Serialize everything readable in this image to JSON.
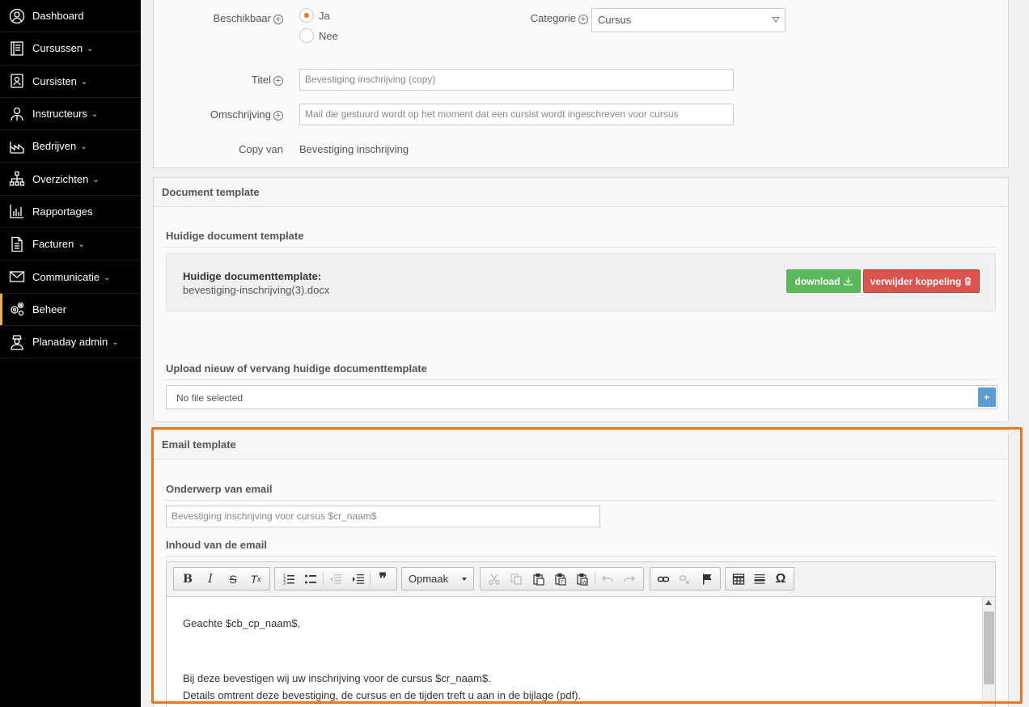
{
  "sidebar": {
    "items": [
      {
        "label": "Dashboard",
        "icon": "user-circle-icon",
        "chevron": false
      },
      {
        "label": "Cursussen",
        "icon": "book-icon",
        "chevron": true
      },
      {
        "label": "Cursisten",
        "icon": "contact-card-icon",
        "chevron": true
      },
      {
        "label": "Instructeurs",
        "icon": "instructor-icon",
        "chevron": true
      },
      {
        "label": "Bedrijven",
        "icon": "factory-icon",
        "chevron": true
      },
      {
        "label": "Overzichten",
        "icon": "sitemap-icon",
        "chevron": true
      },
      {
        "label": "Rapportages",
        "icon": "bar-chart-icon",
        "chevron": false
      },
      {
        "label": "Facturen",
        "icon": "invoice-icon",
        "chevron": true
      },
      {
        "label": "Communicatie",
        "icon": "envelope-icon",
        "chevron": true
      },
      {
        "label": "Beheer",
        "icon": "gears-icon",
        "chevron": false
      },
      {
        "label": "Planaday admin",
        "icon": "admin-icon",
        "chevron": true
      }
    ],
    "chevron_glyph": "⌄",
    "active_accent": "#f0ad4e"
  },
  "form": {
    "beschikbaar_label": "Beschikbaar",
    "radio_ja": "Ja",
    "radio_nee": "Nee",
    "categorie_label": "Categorie",
    "categorie_value": "Cursus",
    "titel_label": "Titel",
    "titel_placeholder": "Bevestiging inschrijving (copy)",
    "omschrijving_label": "Omschrijving",
    "omschrijving_placeholder": "Mail die gestuurd wordt op het moment dat een cursist wordt ingeschreven voor cursus",
    "copy_van_label": "Copy van",
    "copy_van_value": "Bevestiging inschrijving",
    "plus_glyph": "+"
  },
  "document_template": {
    "header": "Document template",
    "current_heading": "Huidige document template",
    "current_label": "Huidige documenttemplate:",
    "current_file": "bevestiging-inschrijving(3).docx",
    "download_label": "download",
    "remove_label": "verwijder koppeling",
    "upload_heading": "Upload nieuw of vervang huidige documenttemplate",
    "file_input_text": "No file selected"
  },
  "email_template": {
    "header": "Email template",
    "subject_heading": "Onderwerp van email",
    "subject_placeholder": "Bevestiging inschrijving voor cursus $cr_naam$",
    "body_heading": "Inhoud van de email",
    "format_dropdown": "Opmaak",
    "body_lines": [
      "Geachte $cb_cp_naam$,",
      "",
      "Bij deze bevestigen wij uw inschrijving voor de cursus $cr_naam$.",
      "Details omtrent deze bevestiging, de cursus en de tijden treft u aan in de bijlage (pdf)."
    ],
    "highlight_color": "#e87722"
  },
  "toolbar": {
    "bold": "B",
    "italic": "I",
    "strike": "S",
    "remove_format": "T",
    "remove_format_sub": "x",
    "quote": "❞",
    "special_char": "Ω"
  },
  "colors": {
    "green": "#5cb85c",
    "red": "#d9534f",
    "upload_button": "#5b9bd5"
  }
}
